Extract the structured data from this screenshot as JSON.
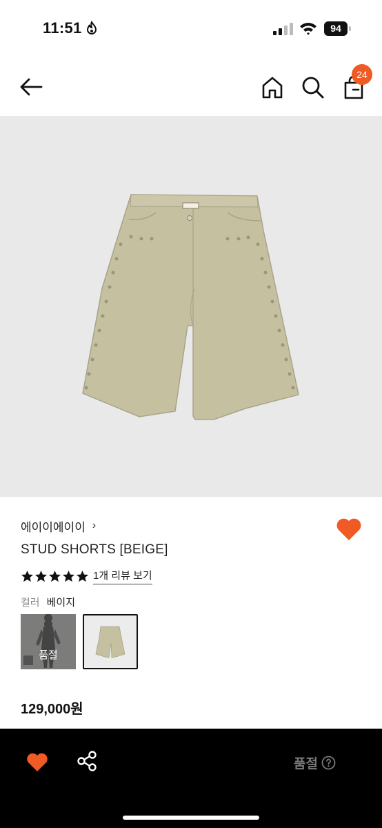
{
  "status_bar": {
    "time": "11:51",
    "battery": "94",
    "icons": [
      "flame-icon",
      "signal-icon",
      "wifi-icon",
      "battery-icon"
    ]
  },
  "header": {
    "icons": [
      "back-arrow-icon",
      "home-icon",
      "search-icon",
      "shopping-bag-icon"
    ],
    "cart_count": "24"
  },
  "colors": {
    "accent": "#f05a24",
    "image_bg": "#e9e9e9",
    "shorts": "#c4c0a0",
    "bottom_bar": "#000000"
  },
  "product": {
    "brand": "에이이에이이",
    "brand_chevron": "›",
    "title": "STUD SHORTS [BEIGE]",
    "rating": 5,
    "review_link": "1개 리뷰 보기",
    "color_label": "컬러",
    "color_value": "베이지",
    "swatches": [
      {
        "name": "model-photo",
        "status": "품절"
      },
      {
        "name": "beige-shorts",
        "selected": true
      }
    ],
    "price": "129,000원"
  },
  "bottom_bar": {
    "status": "품절",
    "icons": [
      "heart-icon",
      "share-icon",
      "help-circle-icon"
    ]
  }
}
